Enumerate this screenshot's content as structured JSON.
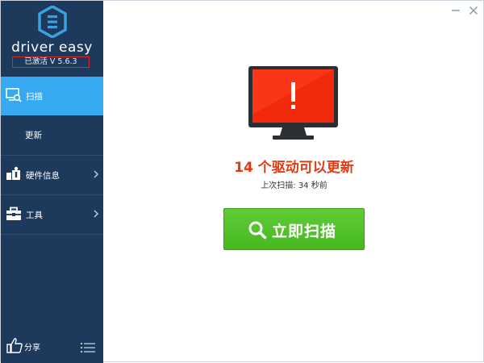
{
  "app": {
    "brand": "driver easy",
    "version_label": "已激活 V 5.6.3"
  },
  "sidebar": {
    "items": [
      {
        "label": "扫描",
        "icon": "scan-monitor-icon",
        "active": true
      },
      {
        "label": "更新",
        "icon": "",
        "active": false
      },
      {
        "label": "硬件信息",
        "icon": "hardware-info-icon",
        "active": false,
        "has_submenu": true
      },
      {
        "label": "工具",
        "icon": "toolbox-icon",
        "active": false,
        "has_submenu": true
      }
    ],
    "footer": {
      "share_label": "分享",
      "share_icon": "thumbs-up-icon",
      "menu_icon": "hamburger-menu-icon"
    }
  },
  "window_controls": {
    "minimize_icon": "minimize-icon",
    "close_icon": "close-icon"
  },
  "main": {
    "monitor_icon": "alert-monitor-icon",
    "headline": "14 个驱动可以更新",
    "last_scan": "上次扫描: 34 秒前",
    "scan_button_label": "立即扫描",
    "scan_button_icon": "search-icon"
  },
  "colors": {
    "sidebar_bg": "#1d3a5c",
    "active_item": "#36a9f0",
    "headline": "#e33a12",
    "scan_button": "#4fc02a",
    "monitor_screen": "#f2290a"
  }
}
